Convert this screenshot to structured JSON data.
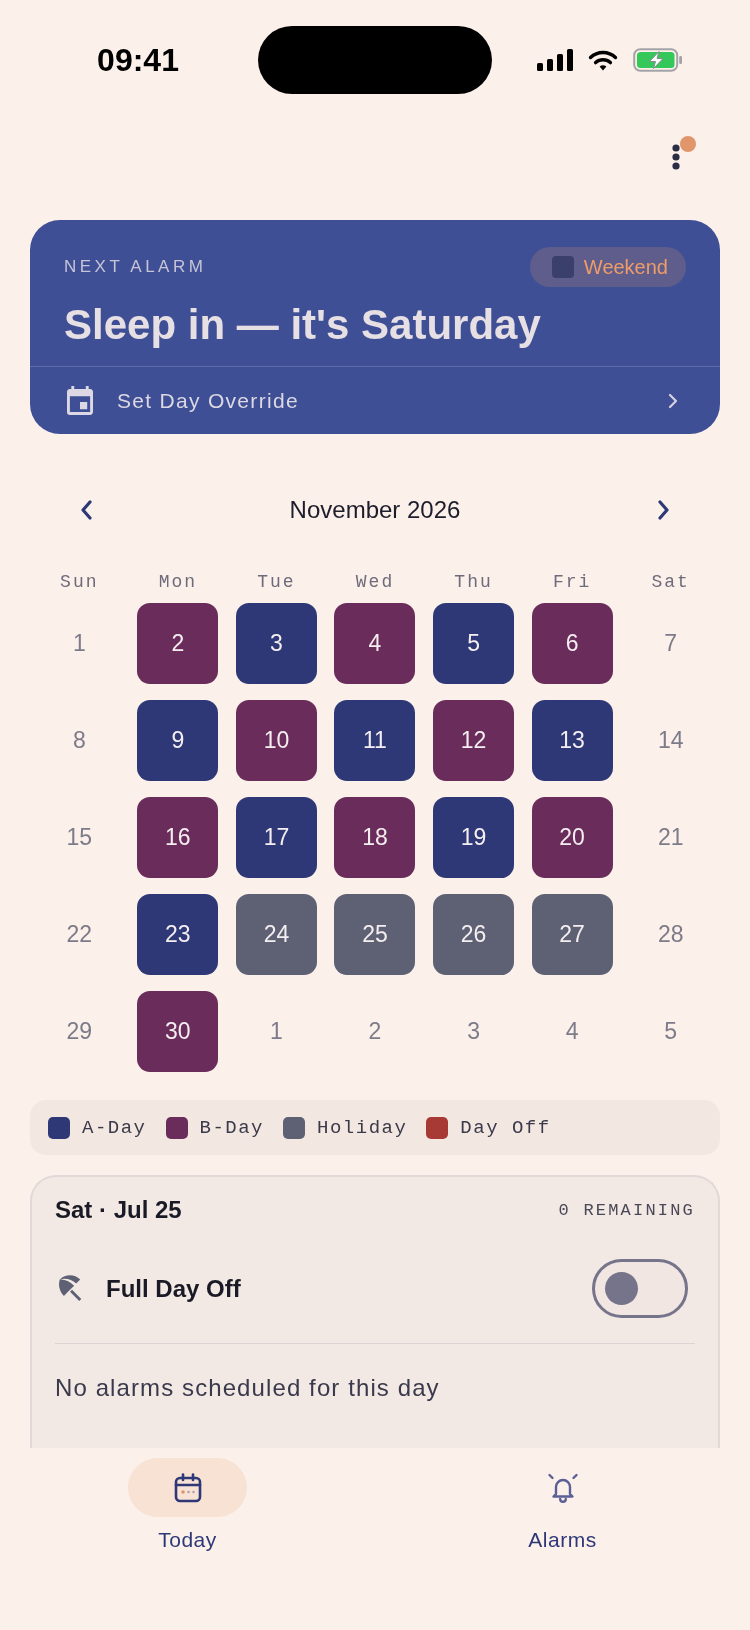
{
  "status_bar": {
    "time": "09:41"
  },
  "header": {
    "menu": {
      "notification": true
    }
  },
  "next_alarm": {
    "label": "NEXT ALARM",
    "title": "Sleep in — it's Saturday",
    "chip": {
      "label": "Weekend"
    },
    "action": {
      "label": "Set Day Override"
    }
  },
  "calendar": {
    "month": "November 2026",
    "weekdays": [
      "Sun",
      "Mon",
      "Tue",
      "Wed",
      "Thu",
      "Fri",
      "Sat"
    ],
    "weeks": [
      [
        {
          "day": "1",
          "kind": "plain"
        },
        {
          "day": "2",
          "kind": "bday"
        },
        {
          "day": "3",
          "kind": "aday"
        },
        {
          "day": "4",
          "kind": "bday"
        },
        {
          "day": "5",
          "kind": "aday"
        },
        {
          "day": "6",
          "kind": "bday"
        },
        {
          "day": "7",
          "kind": "plain"
        }
      ],
      [
        {
          "day": "8",
          "kind": "plain"
        },
        {
          "day": "9",
          "kind": "aday"
        },
        {
          "day": "10",
          "kind": "bday"
        },
        {
          "day": "11",
          "kind": "aday"
        },
        {
          "day": "12",
          "kind": "bday"
        },
        {
          "day": "13",
          "kind": "aday"
        },
        {
          "day": "14",
          "kind": "plain"
        }
      ],
      [
        {
          "day": "15",
          "kind": "plain"
        },
        {
          "day": "16",
          "kind": "bday"
        },
        {
          "day": "17",
          "kind": "aday"
        },
        {
          "day": "18",
          "kind": "bday"
        },
        {
          "day": "19",
          "kind": "aday"
        },
        {
          "day": "20",
          "kind": "bday"
        },
        {
          "day": "21",
          "kind": "plain"
        }
      ],
      [
        {
          "day": "22",
          "kind": "plain"
        },
        {
          "day": "23",
          "kind": "aday"
        },
        {
          "day": "24",
          "kind": "holiday"
        },
        {
          "day": "25",
          "kind": "holiday"
        },
        {
          "day": "26",
          "kind": "holiday"
        },
        {
          "day": "27",
          "kind": "holiday"
        },
        {
          "day": "28",
          "kind": "plain"
        }
      ],
      [
        {
          "day": "29",
          "kind": "plain"
        },
        {
          "day": "30",
          "kind": "bday"
        },
        {
          "day": "1",
          "kind": "plain"
        },
        {
          "day": "2",
          "kind": "plain"
        },
        {
          "day": "3",
          "kind": "plain"
        },
        {
          "day": "4",
          "kind": "plain"
        },
        {
          "day": "5",
          "kind": "plain"
        }
      ]
    ]
  },
  "legend": [
    {
      "kind": "aday",
      "label": "A-Day",
      "color": "#2e3877"
    },
    {
      "kind": "bday",
      "label": "B-Day",
      "color": "#6a2c5a"
    },
    {
      "kind": "holiday",
      "label": "Holiday",
      "color": "#5d6173"
    },
    {
      "kind": "dayoff",
      "label": "Day Off",
      "color": "#a83a36"
    }
  ],
  "day_detail": {
    "date": "Sat · Jul 25",
    "remaining": "0 REMAINING",
    "full_day_off": {
      "label": "Full Day Off",
      "on": false
    },
    "empty_message": "No alarms scheduled for this day"
  },
  "tab_bar": [
    {
      "kind": "today",
      "label": "Today",
      "selected": true
    },
    {
      "kind": "alarms",
      "label": "Alarms",
      "selected": false
    }
  ]
}
